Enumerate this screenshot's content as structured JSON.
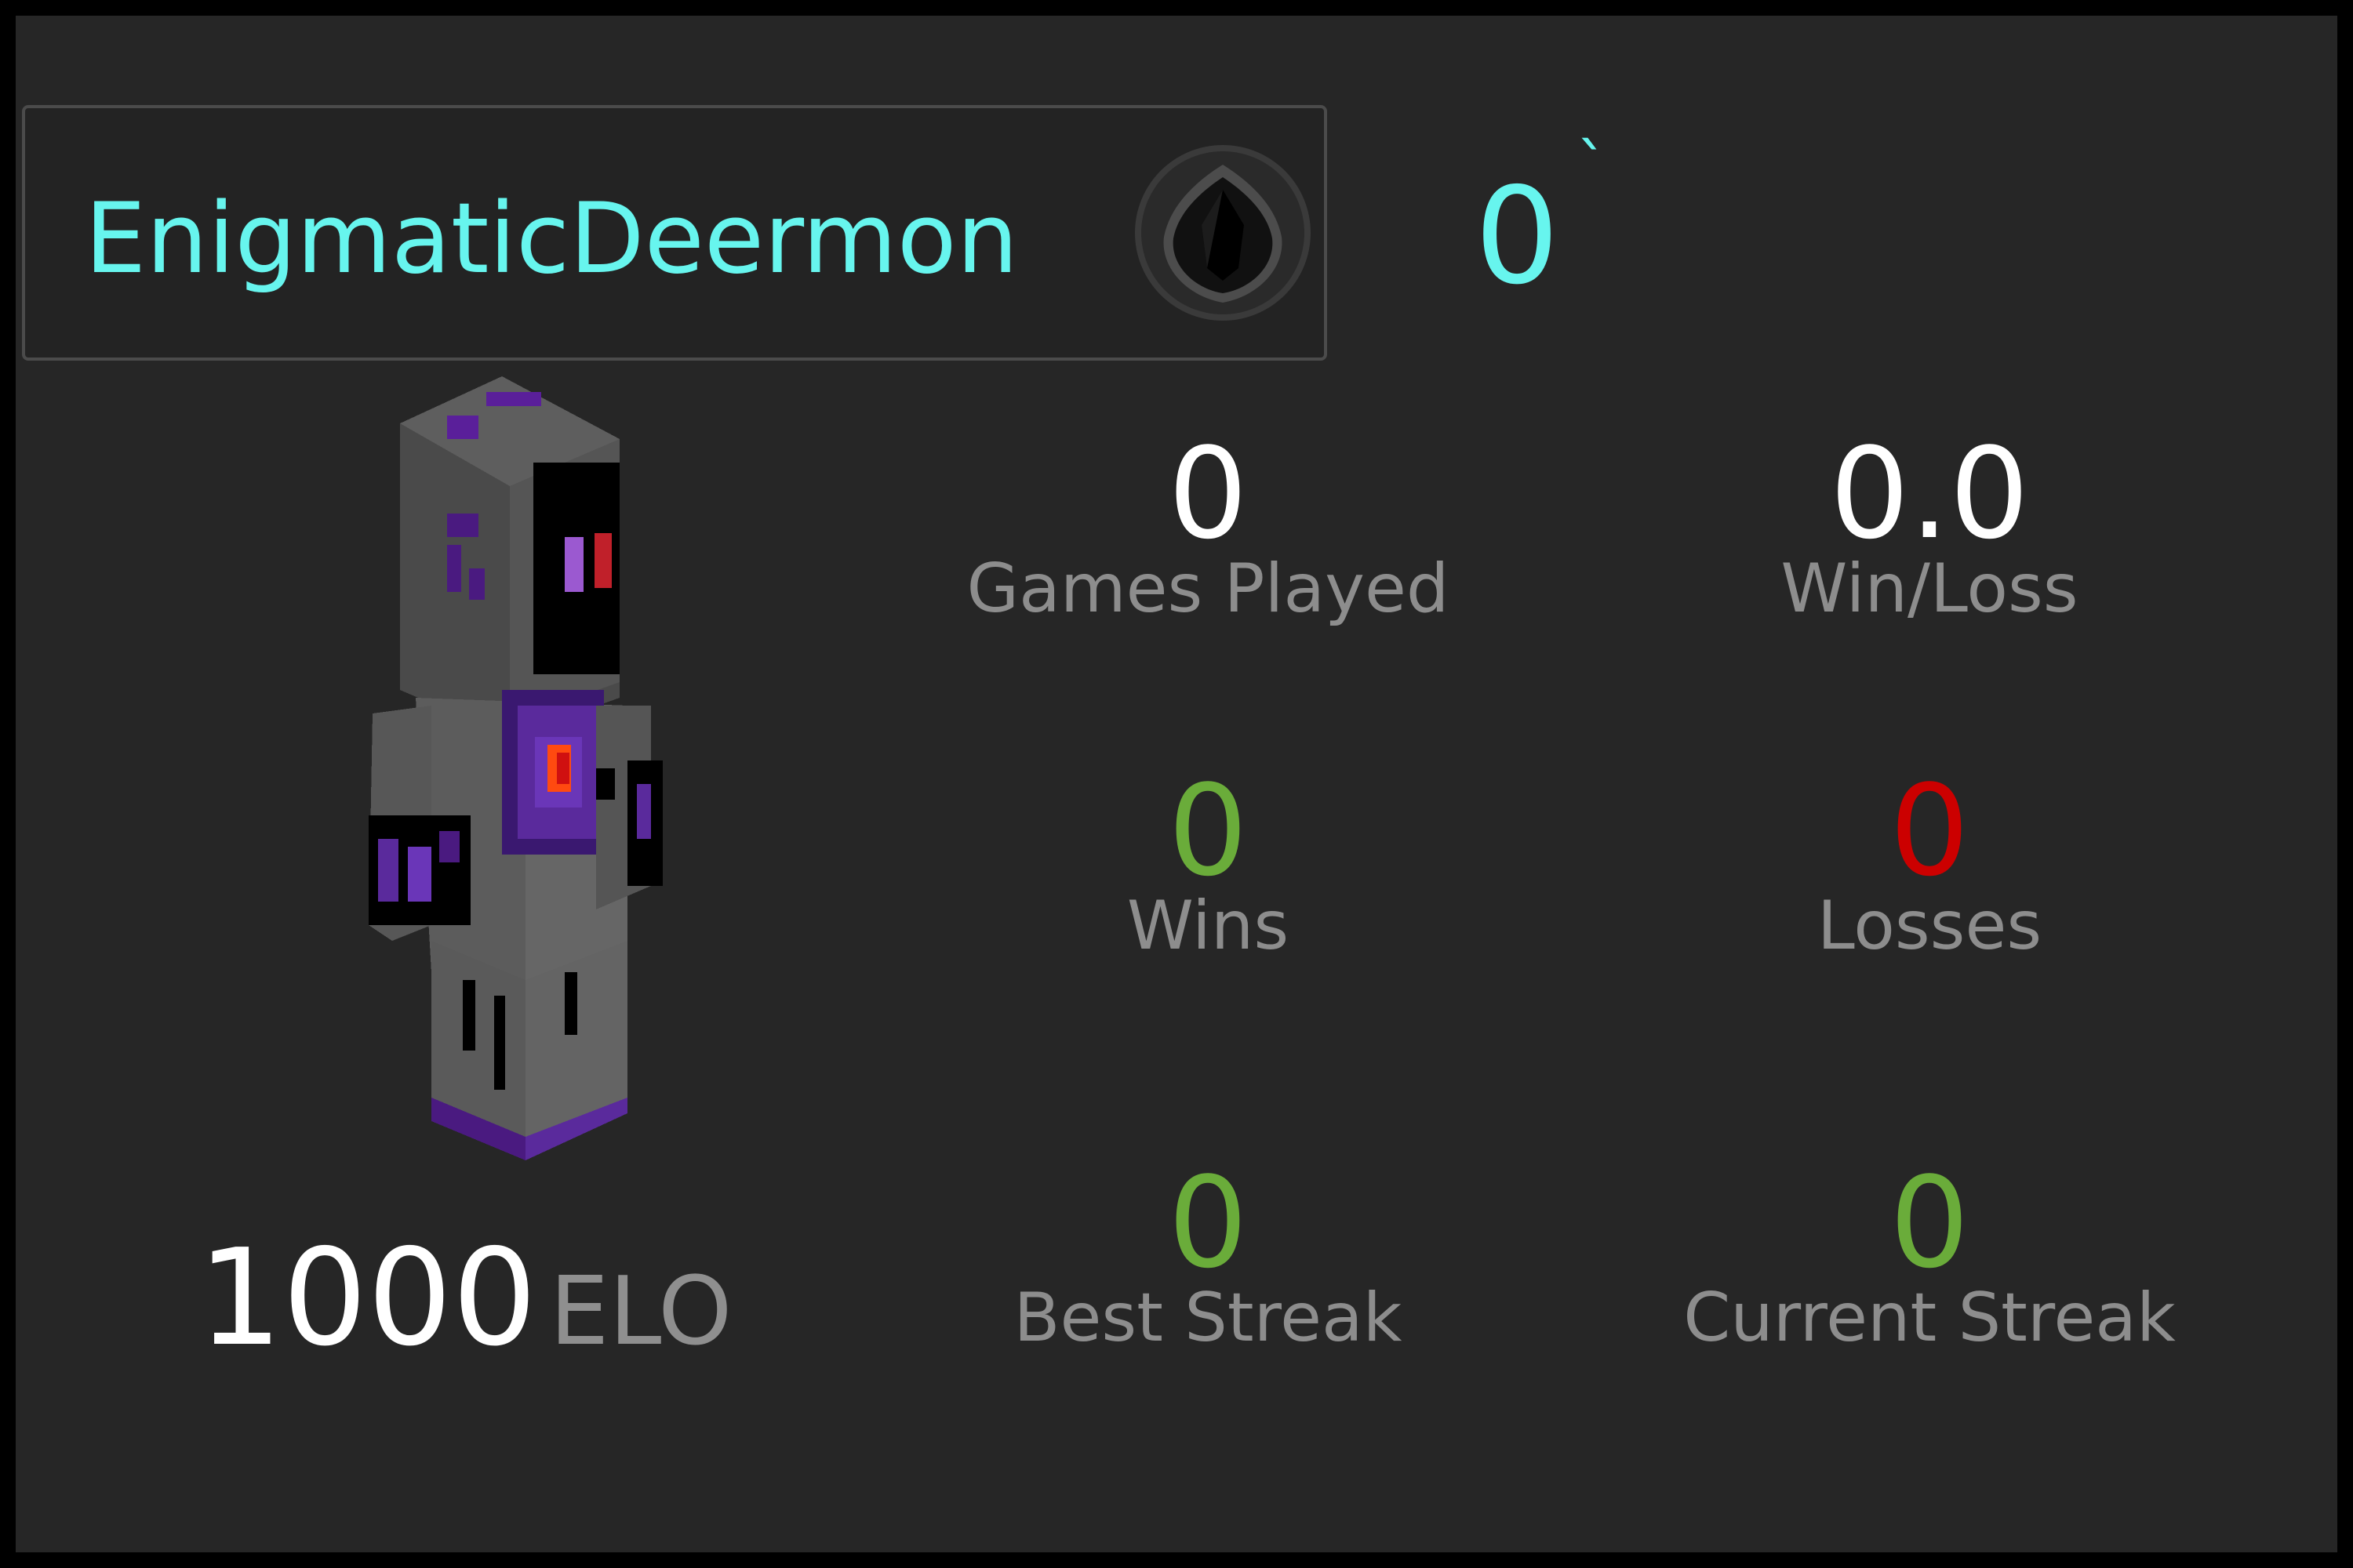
{
  "profile": {
    "name": "EnigmaticDeermon",
    "rank_icon": "dark-gem-rank-icon",
    "rank_value": "0",
    "rank_tick": "`",
    "skin": "minecraft-player-skin"
  },
  "elo": {
    "value": "1000",
    "unit": "ELO"
  },
  "stats": {
    "games_played": {
      "value": "0",
      "label": "Games Played"
    },
    "win_loss": {
      "value": "0.0",
      "label": "Win/Loss"
    },
    "wins": {
      "value": "0",
      "label": "Wins"
    },
    "losses": {
      "value": "0",
      "label": "Losses"
    },
    "best_streak": {
      "value": "0",
      "label": "Best Streak"
    },
    "current_streak": {
      "value": "0",
      "label": "Current Streak"
    }
  },
  "colors": {
    "background": "#262626",
    "name": "#67f5ee",
    "positive": "#6aac3a",
    "negative": "#cc0000",
    "label": "#8d8d8d"
  }
}
